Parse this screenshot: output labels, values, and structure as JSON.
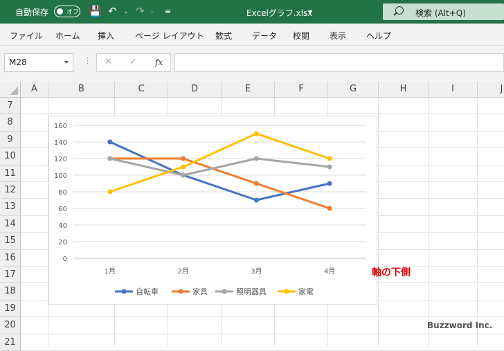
{
  "titlebar": {
    "autosave": "自動保存",
    "toggle_state": "オフ",
    "document": "Excelグラフ.xlsx",
    "search": "検索 (Alt+Q)"
  },
  "menu": [
    "ファイル",
    "ホーム",
    "挿入",
    "ページ レイアウト",
    "数式",
    "データ",
    "校閲",
    "表示",
    "ヘルプ"
  ],
  "namebox": "M28",
  "fx_label": "fx",
  "columns": [
    "A",
    "B",
    "C",
    "D",
    "E",
    "F",
    "G",
    "H",
    "I",
    "J"
  ],
  "rows": [
    "7",
    "8",
    "9",
    "10",
    "11",
    "12",
    "13",
    "14",
    "15",
    "16",
    "17",
    "18",
    "19",
    "20",
    "21"
  ],
  "chart_data": {
    "type": "line",
    "categories": [
      "1月",
      "2月",
      "3月",
      "4月"
    ],
    "series": [
      {
        "name": "自転車",
        "values": [
          140,
          100,
          70,
          90
        ],
        "color": "#4472c4"
      },
      {
        "name": "家具",
        "values": [
          120,
          120,
          90,
          60
        ],
        "color": "#ed7d31"
      },
      {
        "name": "照明器具",
        "values": [
          120,
          100,
          120,
          110
        ],
        "color": "#a5a5a5"
      },
      {
        "name": "家電",
        "values": [
          80,
          110,
          150,
          120
        ],
        "color": "#ffc000"
      }
    ],
    "yticks": [
      "0",
      "20",
      "40",
      "60",
      "80",
      "100",
      "120",
      "140",
      "160"
    ],
    "ylim": [
      0,
      160
    ],
    "grid": true,
    "legend": "bottom"
  },
  "annotation": "軸の下側",
  "watermark": "Buzzword Inc."
}
